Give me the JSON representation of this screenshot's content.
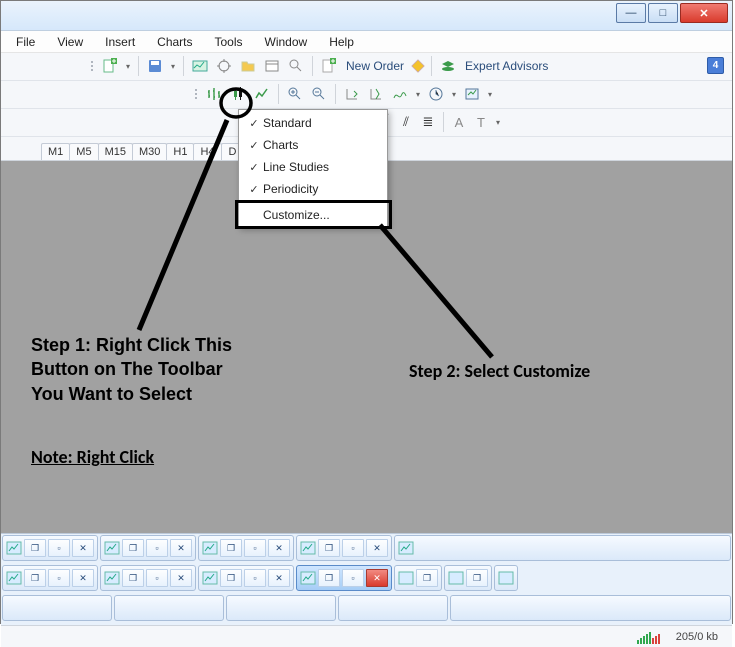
{
  "window": {
    "minimize_glyph": "—",
    "maximize_glyph": "□",
    "close_glyph": "✕"
  },
  "menu": [
    "File",
    "View",
    "Insert",
    "Charts",
    "Tools",
    "Window",
    "Help"
  ],
  "toolbar1": {
    "new_order_label": "New Order",
    "expert_label": "Expert Advisors",
    "badge": "4"
  },
  "periods": [
    "M1",
    "M5",
    "M15",
    "M30",
    "H1",
    "H4",
    "D"
  ],
  "context_menu": {
    "items": [
      {
        "checked": true,
        "label": "Standard"
      },
      {
        "checked": true,
        "label": "Charts"
      },
      {
        "checked": true,
        "label": "Line Studies"
      },
      {
        "checked": true,
        "label": "Periodicity"
      }
    ],
    "customize_label": "Customize..."
  },
  "annotations": {
    "step1_l1": "Step 1: Right Click This",
    "step1_l2": "Button on The Toolbar",
    "step1_l3": "You Want to Select",
    "step2": "Step 2: Select Customize",
    "note": "Note: Right Click"
  },
  "status": {
    "rate": "205/0 kb"
  },
  "taskbar_icons": {
    "cascade": "❐",
    "restore": "▫",
    "close": "✕"
  }
}
